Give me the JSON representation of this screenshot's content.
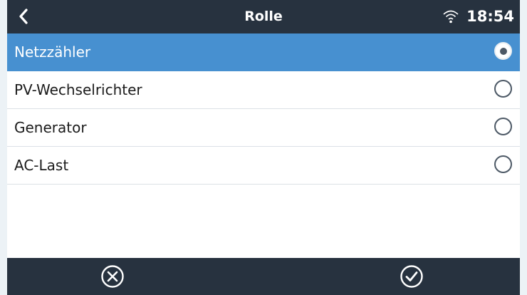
{
  "header": {
    "title": "Rolle",
    "time": "18:54",
    "back_icon": "chevron-left-icon",
    "wifi_icon": "wifi-icon"
  },
  "options": [
    {
      "label": "Netzzähler",
      "selected": true
    },
    {
      "label": "PV-Wechselrichter",
      "selected": false
    },
    {
      "label": "Generator",
      "selected": false
    },
    {
      "label": "AC-Last",
      "selected": false
    }
  ],
  "footer": {
    "cancel_icon": "cancel-circle-icon",
    "confirm_icon": "checkmark-circle-icon"
  },
  "colors": {
    "header_bg": "#27323f",
    "selected_bg": "#4790d0",
    "row_bg": "#ffffff",
    "page_bg": "#ecf2f6"
  }
}
